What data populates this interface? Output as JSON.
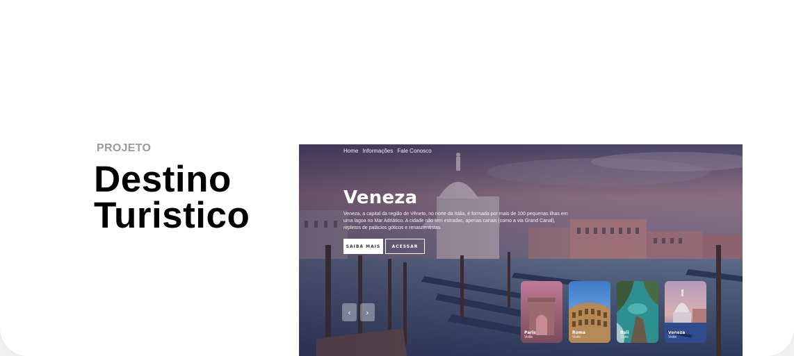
{
  "intro": {
    "eyebrow": "PROJETO",
    "title_line1": "Destino",
    "title_line2": "Turistico"
  },
  "site": {
    "nav": [
      "Home",
      "Informações",
      "Fale Conosco"
    ],
    "hero": {
      "title": "Veneza",
      "description": "Veneza, a capital da região de Vêneto, no norte da Itália, é formada por mais de 100 pequenas ilhas em uma lagoa no Mar Adriático. A cidade não tem estradas, apenas canais (como a via Grand Canal), repletos de palácios góticos e renascentistas.",
      "primary_button": "SAIBA MAIS",
      "secondary_button": "ACESSAR"
    },
    "carousel": {
      "prev_icon": "‹",
      "next_icon": "›",
      "cards": [
        {
          "name": "Paris",
          "subtitle": "Visite"
        },
        {
          "name": "Roma",
          "subtitle": "Visite"
        },
        {
          "name": "Bali",
          "subtitle": "Visite"
        },
        {
          "name": "Veneza",
          "subtitle": "Visite"
        }
      ]
    }
  },
  "colors": {
    "background": "#f1f1f1",
    "card": "#ffffff",
    "eyebrow": "#9a9a9a",
    "hero_tint": "#5a5f80"
  }
}
